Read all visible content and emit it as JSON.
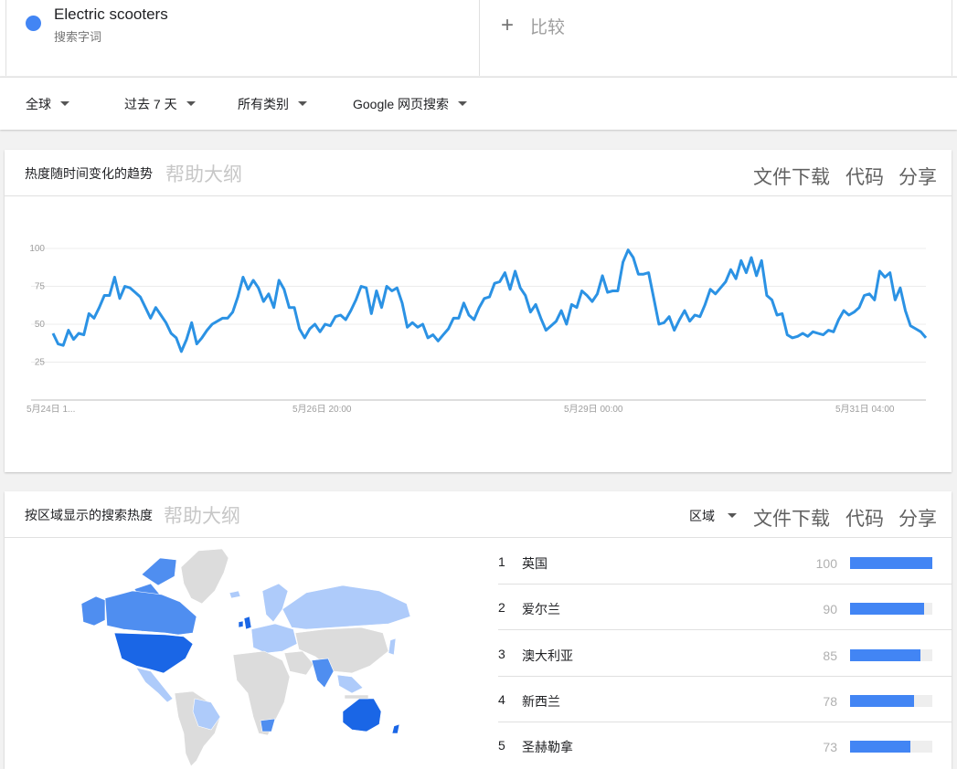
{
  "term": {
    "name": "Electric scooters",
    "type": "搜索字词",
    "color": "#4285f4"
  },
  "compare": {
    "label": "比较"
  },
  "filters": [
    {
      "label": "全球"
    },
    {
      "label": "过去 7 天"
    },
    {
      "label": "所有类别"
    },
    {
      "label": "Google 网页搜索"
    }
  ],
  "trend_card": {
    "title": "热度随时间变化的趋势",
    "help": "帮助大纲",
    "download": "文件下载",
    "embed": "代码",
    "share": "分享"
  },
  "region_card": {
    "title": "按区域显示的搜索热度",
    "help": "帮助大纲",
    "select": "区域",
    "download": "文件下载",
    "embed": "代码",
    "share": "分享",
    "regions": [
      {
        "rank": "1",
        "name": "英国",
        "value": "100",
        "level": 1.0
      },
      {
        "rank": "2",
        "name": "爱尔兰",
        "value": "90",
        "level": 0.9
      },
      {
        "rank": "3",
        "name": "澳大利亚",
        "value": "85",
        "level": 0.85
      },
      {
        "rank": "4",
        "name": "新西兰",
        "value": "78",
        "level": 0.78
      },
      {
        "rank": "5",
        "name": "圣赫勒拿",
        "value": "73",
        "level": 0.73
      }
    ]
  },
  "colors": {
    "accent": "#4285f4",
    "line": "#2b92e4",
    "map_strong": "#1a66e6",
    "map_mid": "#4f8ef0",
    "map_light": "#aecbfa",
    "map_none": "#dcdcdc"
  },
  "chart_data": {
    "type": "line",
    "title": "热度随时间变化的趋势",
    "xlabel": "",
    "ylabel": "",
    "ylim": [
      0,
      100
    ],
    "yticks": [
      25,
      50,
      75,
      100
    ],
    "xtick_labels": [
      "5月24日 1...",
      "5月26日 20:00",
      "5月29日 00:00",
      "5月31日 04:00"
    ],
    "grid": true,
    "series": [
      {
        "name": "Electric scooters",
        "values": [
          44,
          37,
          36,
          46,
          40,
          44,
          43,
          57,
          54,
          61,
          69,
          69,
          81,
          67,
          75,
          74,
          71,
          68,
          61,
          54,
          61,
          56,
          51,
          44,
          41,
          32,
          40,
          51,
          37,
          41,
          46,
          50,
          52,
          54,
          54,
          58,
          68,
          81,
          73,
          79,
          74,
          65,
          70,
          61,
          79,
          73,
          61,
          61,
          47,
          41,
          47,
          50,
          45,
          50,
          49,
          55,
          56,
          53,
          59,
          66,
          75,
          74,
          57,
          72,
          61,
          75,
          72,
          74,
          64,
          48,
          51,
          48,
          50,
          41,
          43,
          39,
          43,
          47,
          54,
          54,
          64,
          56,
          53,
          61,
          67,
          68,
          77,
          78,
          84,
          73,
          85,
          74,
          69,
          58,
          63,
          54,
          46,
          49,
          52,
          59,
          50,
          63,
          61,
          72,
          69,
          65,
          70,
          82,
          71,
          72,
          72,
          91,
          99,
          94,
          83,
          83,
          84,
          67,
          50,
          51,
          55,
          46,
          53,
          59,
          52,
          56,
          55,
          63,
          73,
          70,
          74,
          78,
          86,
          80,
          92,
          84,
          94,
          82,
          92,
          69,
          66,
          56,
          57,
          43,
          41,
          42,
          44,
          42,
          45,
          44,
          43,
          46,
          45,
          53,
          59,
          56,
          58,
          61,
          69,
          70,
          66,
          85,
          81,
          84,
          66,
          74,
          59,
          49,
          47,
          45,
          41
        ]
      }
    ]
  }
}
